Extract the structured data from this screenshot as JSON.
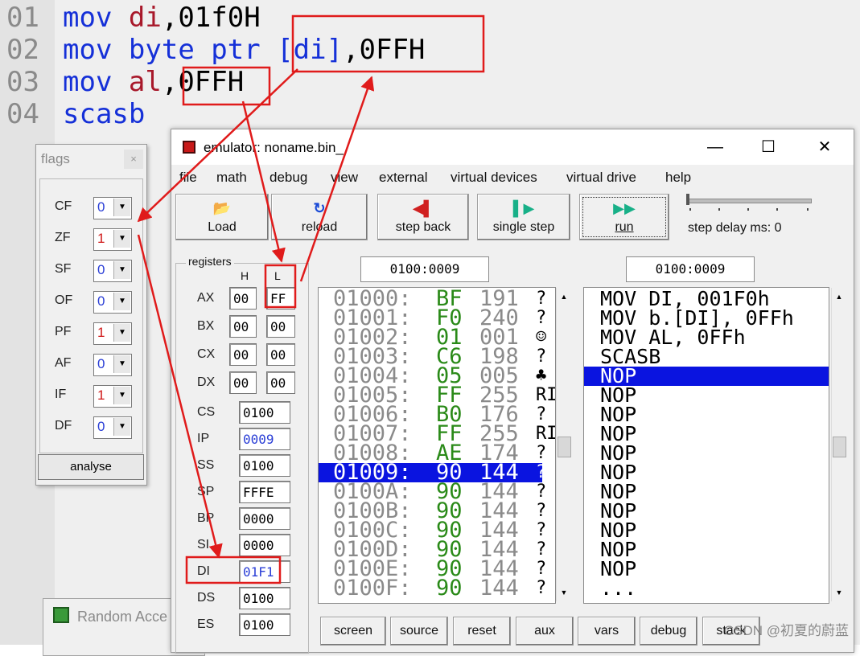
{
  "code_editor": {
    "lines": [
      {
        "num": "01",
        "op": "mov",
        "args": [
          {
            "t": "di",
            "c": "reg"
          },
          {
            "t": ",01f0H",
            "c": "txt"
          }
        ]
      },
      {
        "num": "02",
        "op": "mov",
        "args": [
          {
            "t": "byte ptr ",
            "c": "kw"
          },
          {
            "t": "[di]",
            "c": "kw"
          },
          {
            "t": ",0FFH",
            "c": "txt"
          }
        ]
      },
      {
        "num": "03",
        "op": "mov",
        "args": [
          {
            "t": "al",
            "c": "reg"
          },
          {
            "t": ",0FFH",
            "c": "txt"
          }
        ]
      },
      {
        "num": "04",
        "op": "scasb",
        "args": []
      }
    ]
  },
  "flags_window": {
    "title": "flags",
    "close": "×",
    "dropdown_glyph": "▼",
    "flags": [
      {
        "name": "CF",
        "value": "0",
        "color": "#2a3ed6"
      },
      {
        "name": "ZF",
        "value": "1",
        "color": "#d01818"
      },
      {
        "name": "SF",
        "value": "0",
        "color": "#2a3ed6"
      },
      {
        "name": "OF",
        "value": "0",
        "color": "#2a3ed6"
      },
      {
        "name": "PF",
        "value": "1",
        "color": "#d01818"
      },
      {
        "name": "AF",
        "value": "0",
        "color": "#2a3ed6"
      },
      {
        "name": "IF",
        "value": "1",
        "color": "#d01818"
      },
      {
        "name": "DF",
        "value": "0",
        "color": "#2a3ed6"
      }
    ],
    "analyse_label": "analyse"
  },
  "random_window": {
    "title": "Random Acce"
  },
  "emulator": {
    "title": "emulator: noname.bin_",
    "window_buttons": {
      "minimize": "—",
      "maximize": "☐",
      "close": "✕"
    },
    "menu": [
      "file",
      "math",
      "debug",
      "view",
      "external",
      "virtual devices",
      "virtual drive",
      "help"
    ],
    "toolbar": {
      "load": {
        "label": "Load",
        "icon": "📂"
      },
      "reload": {
        "label": "reload",
        "icon": "↻"
      },
      "step_back": {
        "label": "step back",
        "icon": "◀▌"
      },
      "single_step": {
        "label": "single step",
        "icon": "▌▶"
      },
      "run": {
        "label": "run",
        "icon": "▶▶"
      }
    },
    "step_delay_label": "step delay ms: 0",
    "registers_label": "registers",
    "h_label": "H",
    "l_label": "L",
    "general_regs": [
      {
        "name": "AX",
        "h": "00",
        "l": "FF"
      },
      {
        "name": "BX",
        "h": "00",
        "l": "00"
      },
      {
        "name": "CX",
        "h": "00",
        "l": "00"
      },
      {
        "name": "DX",
        "h": "00",
        "l": "00"
      }
    ],
    "seg_regs": [
      {
        "name": "CS",
        "value": "0100",
        "blue": false
      },
      {
        "name": "IP",
        "value": "0009",
        "blue": true
      },
      {
        "name": "SS",
        "value": "0100",
        "blue": false
      },
      {
        "name": "SP",
        "value": "FFFE",
        "blue": false
      },
      {
        "name": "BP",
        "value": "0000",
        "blue": false
      },
      {
        "name": "SI",
        "value": "0000",
        "blue": false
      },
      {
        "name": "DI",
        "value": "01F1",
        "blue": true
      },
      {
        "name": "DS",
        "value": "0100",
        "blue": false
      },
      {
        "name": "ES",
        "value": "0100",
        "blue": false
      }
    ],
    "mem_address": "0100:0009",
    "dis_address": "0100:0009",
    "memory": [
      {
        "addr": "01000:",
        "hex": "BF",
        "dec": "191",
        "chr": "?"
      },
      {
        "addr": "01001:",
        "hex": "F0",
        "dec": "240",
        "chr": "?"
      },
      {
        "addr": "01002:",
        "hex": "01",
        "dec": "001",
        "chr": "☺"
      },
      {
        "addr": "01003:",
        "hex": "C6",
        "dec": "198",
        "chr": "?"
      },
      {
        "addr": "01004:",
        "hex": "05",
        "dec": "005",
        "chr": "♣"
      },
      {
        "addr": "01005:",
        "hex": "FF",
        "dec": "255",
        "chr": "RI"
      },
      {
        "addr": "01006:",
        "hex": "B0",
        "dec": "176",
        "chr": "?"
      },
      {
        "addr": "01007:",
        "hex": "FF",
        "dec": "255",
        "chr": "RI"
      },
      {
        "addr": "01008:",
        "hex": "AE",
        "dec": "174",
        "chr": "?"
      },
      {
        "addr": "01009:",
        "hex": "90",
        "dec": "144",
        "chr": "?",
        "selected": true
      },
      {
        "addr": "0100A:",
        "hex": "90",
        "dec": "144",
        "chr": "?"
      },
      {
        "addr": "0100B:",
        "hex": "90",
        "dec": "144",
        "chr": "?"
      },
      {
        "addr": "0100C:",
        "hex": "90",
        "dec": "144",
        "chr": "?"
      },
      {
        "addr": "0100D:",
        "hex": "90",
        "dec": "144",
        "chr": "?"
      },
      {
        "addr": "0100E:",
        "hex": "90",
        "dec": "144",
        "chr": "?"
      },
      {
        "addr": "0100F:",
        "hex": "90",
        "dec": "144",
        "chr": "?"
      }
    ],
    "disassembly": [
      {
        "text": "MOV DI, 001F0h"
      },
      {
        "text": "MOV b.[DI], 0FFh"
      },
      {
        "text": "MOV AL, 0FFh"
      },
      {
        "text": "SCASB"
      },
      {
        "text": "NOP",
        "selected": true
      },
      {
        "text": "NOP"
      },
      {
        "text": "NOP"
      },
      {
        "text": "NOP"
      },
      {
        "text": "NOP"
      },
      {
        "text": "NOP"
      },
      {
        "text": "NOP"
      },
      {
        "text": "NOP"
      },
      {
        "text": "NOP"
      },
      {
        "text": "NOP"
      },
      {
        "text": "NOP"
      },
      {
        "text": "..."
      }
    ],
    "bottom_buttons": [
      "screen",
      "source",
      "reset",
      "aux",
      "vars",
      "debug",
      "stack"
    ]
  },
  "scroll_glyphs": {
    "up": "▲",
    "down": "▼"
  },
  "watermark": "CSDN @初夏的蔚蓝",
  "colors": {
    "annotation": "#e01b1b",
    "selection": "#0a14e0",
    "hex_green": "#2a8a18"
  }
}
